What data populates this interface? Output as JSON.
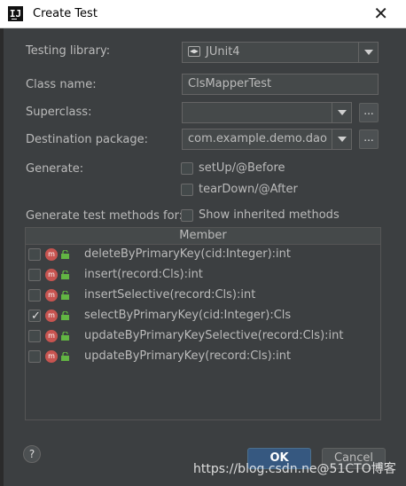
{
  "window": {
    "title": "Create Test",
    "app_icon": "intellij-logo",
    "app_icon_text": "IJ"
  },
  "form": {
    "testing_library_label": "Testing library:",
    "testing_library_value": "JUnit4",
    "class_name_label": "Class name:",
    "class_name_value": "ClsMapperTest",
    "superclass_label": "Superclass:",
    "superclass_value": "",
    "destination_label": "Destination package:",
    "destination_value": "com.example.demo.dao",
    "ellipsis": "...",
    "generate_label": "Generate:",
    "setup_label": "setUp/@Before",
    "teardown_label": "tearDown/@After",
    "methods_label": "Generate test methods for:",
    "show_inherited_label": "Show inherited methods"
  },
  "table": {
    "header": "Member",
    "rows": [
      {
        "name": "deleteByPrimaryKey(cid:Integer):int",
        "checked": false
      },
      {
        "name": "insert(record:Cls):int",
        "checked": false
      },
      {
        "name": "insertSelective(record:Cls):int",
        "checked": false
      },
      {
        "name": "selectByPrimaryKey(cid:Integer):Cls",
        "checked": true
      },
      {
        "name": "updateByPrimaryKeySelective(record:Cls):int",
        "checked": false
      },
      {
        "name": "updateByPrimaryKey(record:Cls):int",
        "checked": false
      }
    ]
  },
  "buttons": {
    "help": "?",
    "ok": "OK",
    "cancel": "Cancel"
  },
  "watermark": "https://blog.csdn.ne@51CTO博客",
  "colors": {
    "background": "#3c3f41",
    "accent": "#365880",
    "method_icon": "#c75450",
    "lock_icon": "#62b543"
  }
}
